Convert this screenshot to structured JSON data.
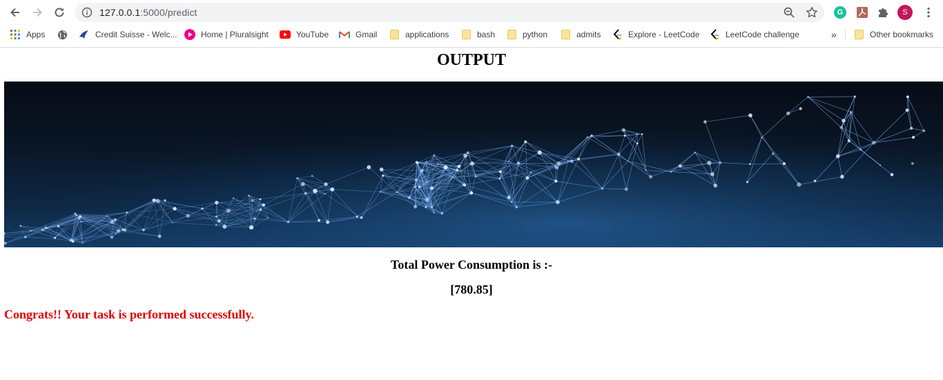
{
  "browser": {
    "url_host": "127.0.0.1",
    "url_rest": ":5000/predict",
    "profile_initial": "S",
    "grammarly_letter": "G",
    "bookmarks": [
      {
        "label": "Apps",
        "icon": "apps-grid-icon"
      },
      {
        "label": "",
        "icon": "globe-icon"
      },
      {
        "label": "Credit Suisse - Welc...",
        "icon": "credit-suisse-icon"
      },
      {
        "label": "Home | Pluralsight",
        "icon": "pluralsight-icon"
      },
      {
        "label": "YouTube",
        "icon": "youtube-icon"
      },
      {
        "label": "Gmail",
        "icon": "gmail-icon"
      },
      {
        "label": "applications",
        "icon": "folder-icon"
      },
      {
        "label": "bash",
        "icon": "folder-icon"
      },
      {
        "label": "python",
        "icon": "folder-icon"
      },
      {
        "label": "admits",
        "icon": "folder-icon"
      },
      {
        "label": "Explore - LeetCode",
        "icon": "leetcode-icon"
      },
      {
        "label": "LeetCode challenge",
        "icon": "leetcode-icon"
      }
    ],
    "overflow_label": "»",
    "other_bookmarks": "Other bookmarks"
  },
  "page": {
    "title": "OUTPUT",
    "result_label": "Total Power Consumption is :-",
    "result_value": "[780.85]",
    "success_message": "Congrats!! Your task is performed successfully."
  },
  "colors": {
    "success_text": "#e00000",
    "banner_glow": "#7fb8ff"
  }
}
